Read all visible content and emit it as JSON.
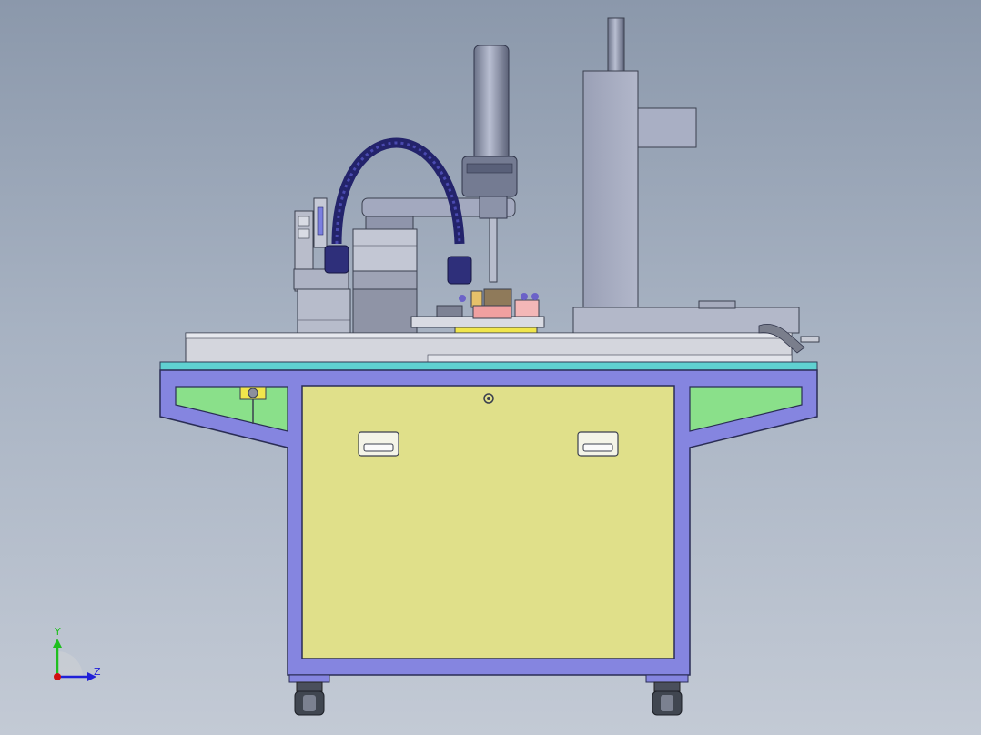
{
  "viewport": {
    "background_top": "#8b98ab",
    "background_bottom": "#c3cad5"
  },
  "model": {
    "frame_color": "#8585e0",
    "door_color": "#e0e08a",
    "side_panel_color": "#8ae08a",
    "table_edge_color": "#5fd1d1",
    "machine_gray": "#a9afc4",
    "hose_color": "#23236b",
    "caster_color": "#404650"
  },
  "triad": {
    "y_label": "Y",
    "z_label": "Z",
    "y_color": "#1fbf1f",
    "z_color": "#2020d8",
    "origin_color": "#d01010"
  }
}
